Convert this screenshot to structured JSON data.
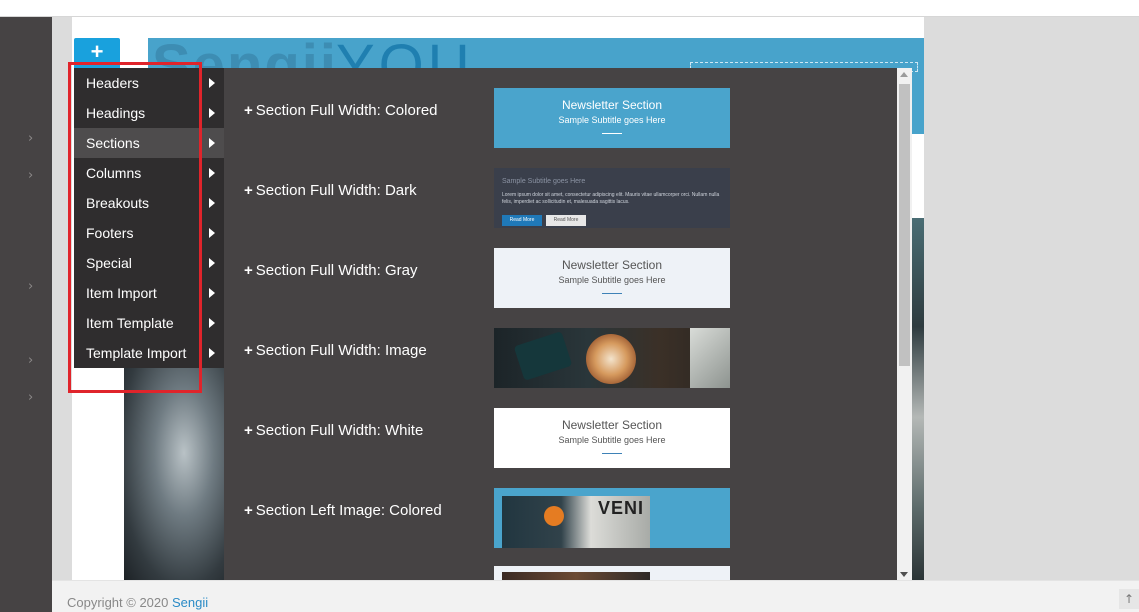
{
  "builder": {
    "add_button_label": "+",
    "hero_ghost_text": "Sengii",
    "hero_ghost_text2": "YOU"
  },
  "menu": {
    "items": [
      {
        "label": "Headers",
        "active": false
      },
      {
        "label": "Headings",
        "active": false
      },
      {
        "label": "Sections",
        "active": true
      },
      {
        "label": "Columns",
        "active": false
      },
      {
        "label": "Breakouts",
        "active": false
      },
      {
        "label": "Footers",
        "active": false
      },
      {
        "label": "Special",
        "active": false
      },
      {
        "label": "Item Import",
        "active": false
      },
      {
        "label": "Item Template",
        "active": false
      },
      {
        "label": "Template Import",
        "active": false
      }
    ]
  },
  "sections": [
    {
      "label": "Section Full Width: Colored",
      "style": "colored",
      "title": "Newsletter Section",
      "subtitle": "Sample Subtitle goes Here"
    },
    {
      "label": "Section Full Width: Dark",
      "style": "dark",
      "subtitle": "Sample Subtitle goes Here",
      "body": "Lorem ipsum dolor sit amet, consectetur adipiscing elit. Mauris vitae ullamcorper orci. Nullam nulla felis, imperdiet ac sollicitudin et, malesuada sagittis lacus.",
      "button_primary": "Read More",
      "button_secondary": "Read More"
    },
    {
      "label": "Section Full Width: Gray",
      "style": "gray",
      "title": "Newsletter Section",
      "subtitle": "Sample Subtitle goes Here"
    },
    {
      "label": "Section Full Width: Image",
      "style": "image"
    },
    {
      "label": "Section Full Width: White",
      "style": "white",
      "title": "Newsletter Section",
      "subtitle": "Sample Subtitle goes Here"
    },
    {
      "label": "Section Left Image: Colored",
      "style": "leftimg",
      "image_text": "VENI"
    }
  ],
  "footer": {
    "copyright": "Copyright © 2020",
    "brand": "Sengii"
  },
  "colors": {
    "accent": "#19a1dd",
    "highlight": "#e0242b",
    "panel": "#464344",
    "menu": "#2f2d2e",
    "thumb_colored": "#4aa4cc"
  },
  "icons": {
    "menu_caret": "caret-right-icon",
    "rail_chevron": "chevron-right-icon",
    "back_to_top": "arrow-up-icon"
  }
}
